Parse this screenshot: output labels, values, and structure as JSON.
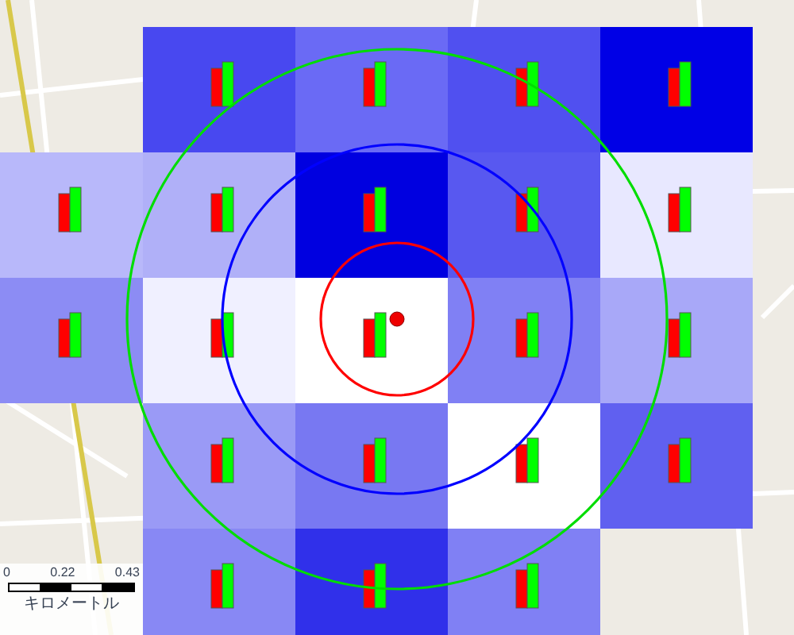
{
  "grid_rows": [
    {
      "cells": [
        {
          "kind": "none"
        },
        {
          "kind": "shaded",
          "color": "#4848f0"
        },
        {
          "kind": "shaded",
          "color": "#6a6af5"
        },
        {
          "kind": "shaded",
          "color": "#5050f0"
        },
        {
          "kind": "shaded",
          "color": "#0000e6"
        }
      ]
    },
    {
      "cells": [
        {
          "kind": "shaded",
          "color": "#b8b8fa"
        },
        {
          "kind": "shaded",
          "color": "#b0b0f8"
        },
        {
          "kind": "shaded",
          "color": "#0000e0"
        },
        {
          "kind": "shaded",
          "color": "#5858f0"
        },
        {
          "kind": "shaded",
          "color": "#e8e8ff"
        }
      ]
    },
    {
      "cells": [
        {
          "kind": "shaded",
          "color": "#8c8cf4"
        },
        {
          "kind": "shaded",
          "color": "#f0f0ff"
        },
        {
          "kind": "shaded",
          "color": "#ffffff"
        },
        {
          "kind": "shaded",
          "color": "#8080f4"
        },
        {
          "kind": "shaded",
          "color": "#a8a8f8"
        }
      ]
    },
    {
      "cells": [
        {
          "kind": "none"
        },
        {
          "kind": "shaded",
          "color": "#9a9af6"
        },
        {
          "kind": "shaded",
          "color": "#7878f2"
        },
        {
          "kind": "shaded",
          "color": "#ffffff"
        },
        {
          "kind": "shaded",
          "color": "#6060f0"
        }
      ]
    },
    {
      "cells": [
        {
          "kind": "none"
        },
        {
          "kind": "shaded",
          "color": "#8888f4"
        },
        {
          "kind": "shaded",
          "color": "#3030ea"
        },
        {
          "kind": "shaded",
          "color": "#8080f4"
        },
        {
          "kind": "none"
        }
      ]
    }
  ],
  "range_circles": [
    {
      "color": "#ff0000"
    },
    {
      "color": "#0000ff"
    },
    {
      "color": "#00dd00"
    }
  ],
  "scale_bar": {
    "labels": [
      "0",
      "0.22",
      "0.43"
    ],
    "unit": "キロメートル"
  }
}
